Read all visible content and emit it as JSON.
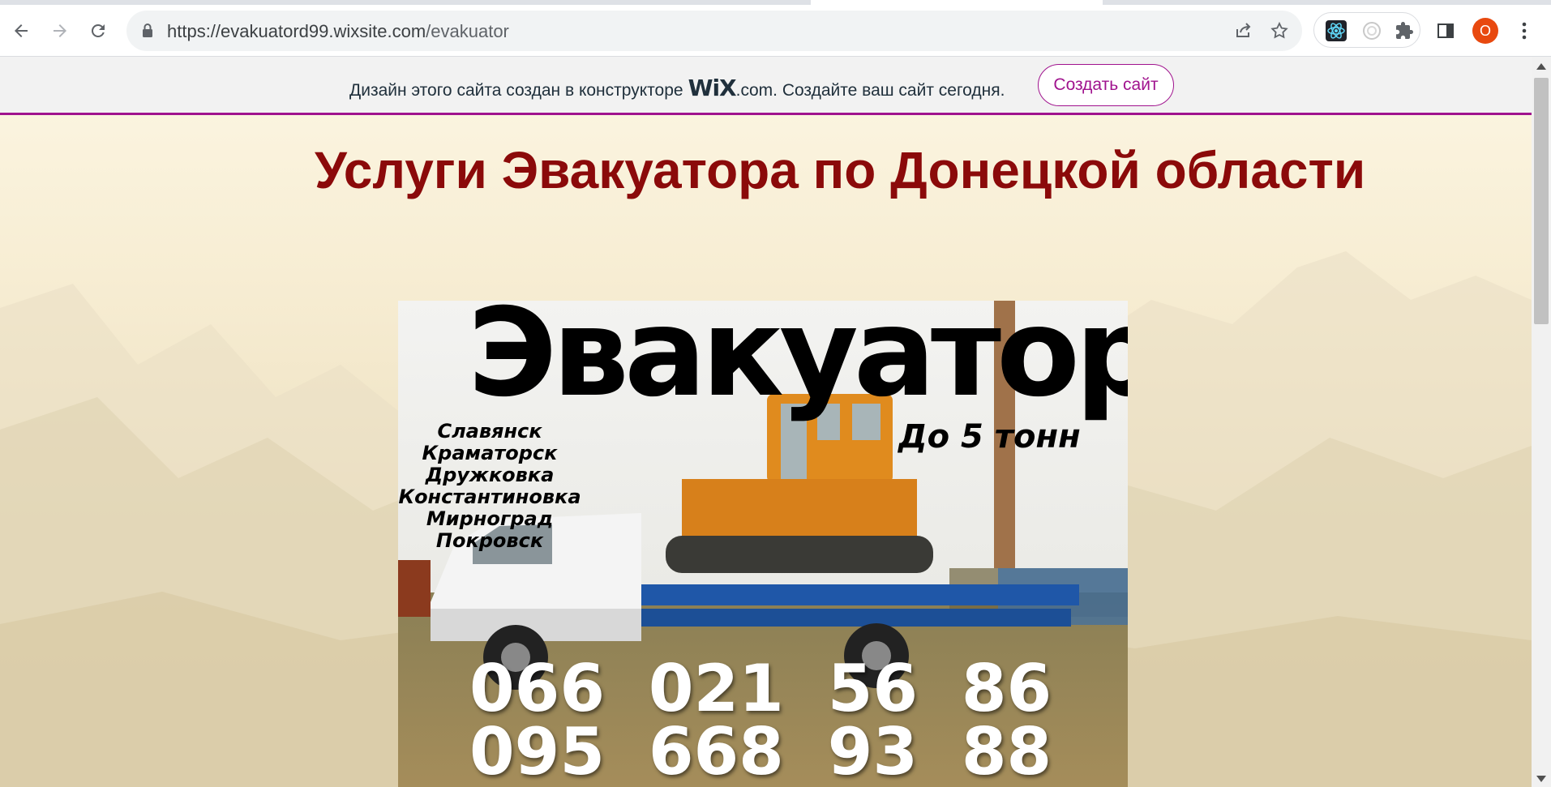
{
  "browser": {
    "url_host": "https://evakuatord99.wixsite.com",
    "url_path": "/evakuator",
    "profile_initial": "O",
    "icons": [
      "back-icon",
      "forward-icon",
      "reload-icon",
      "lock-icon",
      "share-icon",
      "star-icon",
      "react-devtools-icon",
      "extension-icon",
      "puzzle-icon",
      "side-panel-icon",
      "menu-icon"
    ]
  },
  "wix_banner": {
    "text_before": "Дизайн этого сайта создан в конструкторе",
    "logo_text": "WiX",
    "text_after": ".com. Создайте ваш сайт сегодня.",
    "button_label": "Создать сайт",
    "accent_color": "#a0138e"
  },
  "page": {
    "headline": "Услуги Эвакуатора по Донецкой области",
    "headline_color": "#8b0a0a"
  },
  "poster": {
    "title": "Эвакуатор",
    "capacity": "До 5 тонн",
    "cities": [
      "Славянск",
      "Краматорск",
      "Дружковка",
      "Константиновка",
      "Мирноград",
      "Покровск"
    ],
    "phones": [
      "066 021 56 86",
      "095 668 93 88"
    ]
  }
}
